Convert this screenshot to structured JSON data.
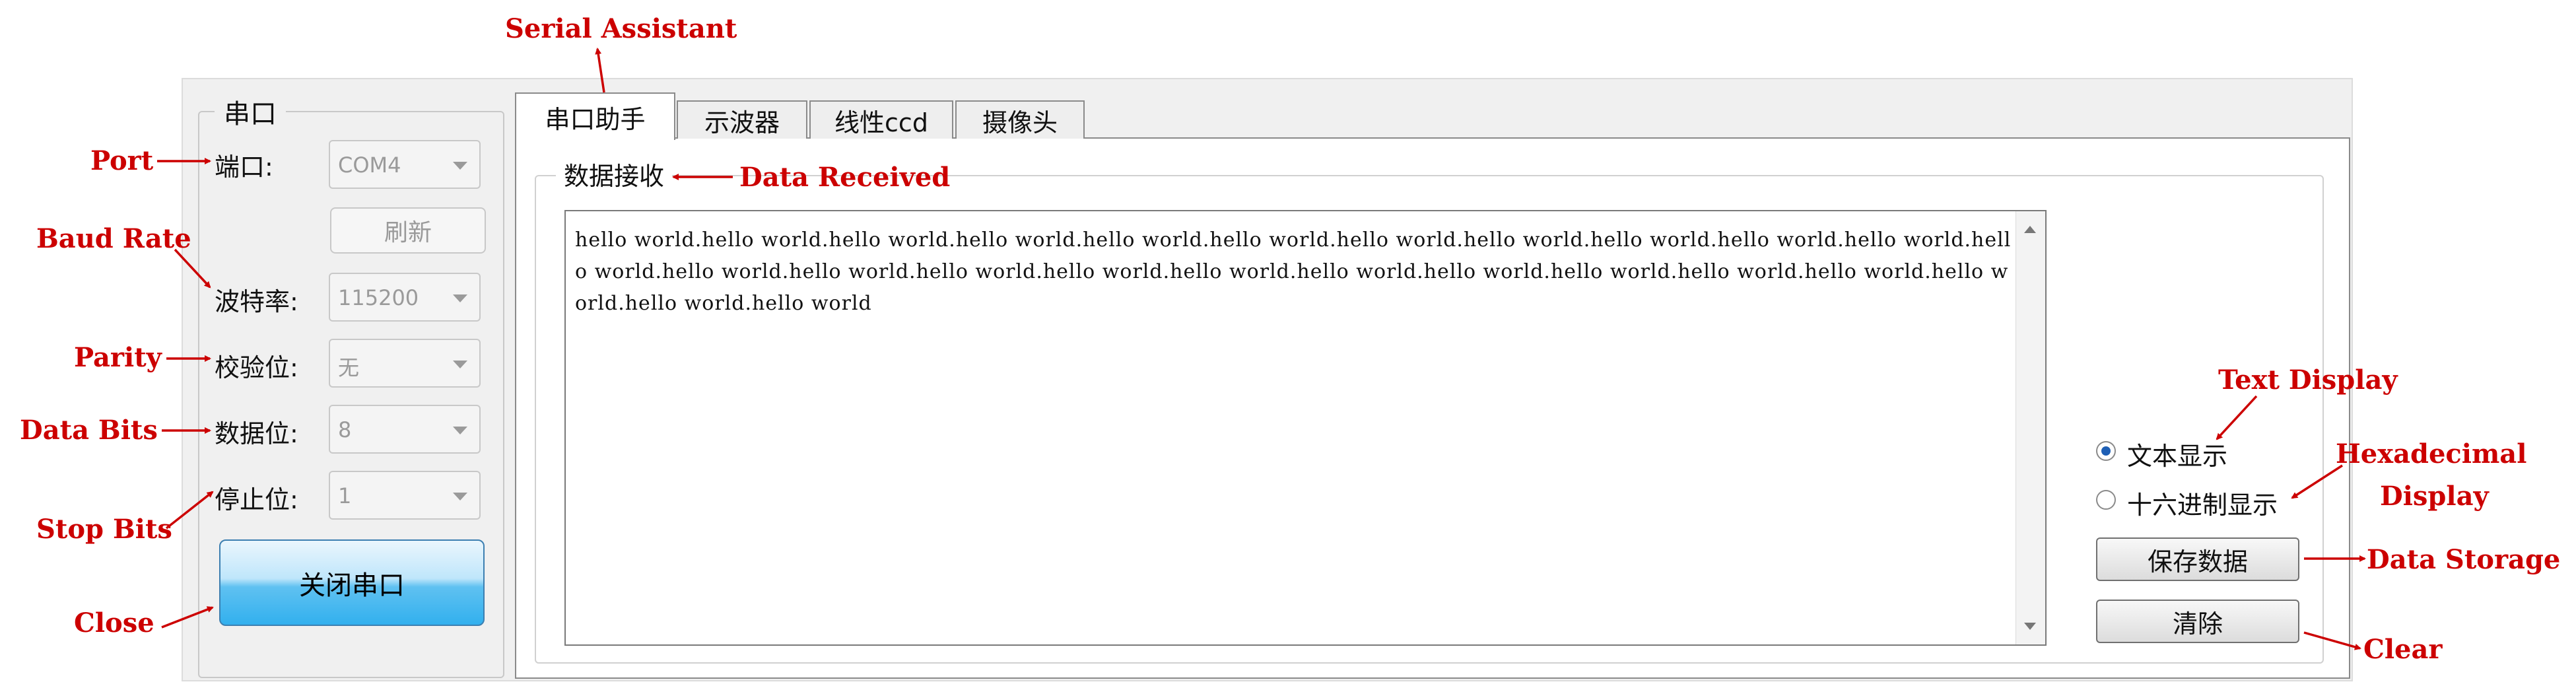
{
  "serial_panel": {
    "title": "串口",
    "port": {
      "label": "端口:",
      "value": "COM4"
    },
    "refresh_label": "刷新",
    "baud": {
      "label": "波特率:",
      "value": "115200"
    },
    "parity": {
      "label": "校验位:",
      "value": "无"
    },
    "databits": {
      "label": "数据位:",
      "value": "8"
    },
    "stopbits": {
      "label": "停止位:",
      "value": "1"
    },
    "close_label": "关闭串口"
  },
  "tabs": [
    {
      "label": "串口助手",
      "active": true
    },
    {
      "label": "示波器",
      "active": false
    },
    {
      "label": "线性ccd",
      "active": false
    },
    {
      "label": "摄像头",
      "active": false
    }
  ],
  "receive": {
    "title": "数据接收",
    "text": "hello world.hello world.hello world.hello world.hello world.hello world.hello world.hello world.hello world.hello world.hello world.hello world.hello world.hello world.hello world.hello world.hello world.hello world.hello world.hello world.hello world.hello world.hello world.hello world.hello world"
  },
  "display_options": {
    "text_label": "文本显示",
    "hex_label": "十六进制显示",
    "selected": "text"
  },
  "buttons": {
    "save_label": "保存数据",
    "clear_label": "清除"
  },
  "annotations": {
    "serial_assistant": "Serial Assistant",
    "port": "Port",
    "baud_rate": "Baud Rate",
    "parity": "Parity",
    "data_bits": "Data Bits",
    "stop_bits": "Stop Bits",
    "close": "Close",
    "data_received": "Data Received",
    "text_display": "Text Display",
    "hex_display_line1": "Hexadecimal",
    "hex_display_line2": "Display",
    "data_storage": "Data Storage",
    "clear": "Clear"
  },
  "colors": {
    "annotation": "#cc0000",
    "close_button": "#32b0ee",
    "radio_selected": "#1e5fb5"
  }
}
